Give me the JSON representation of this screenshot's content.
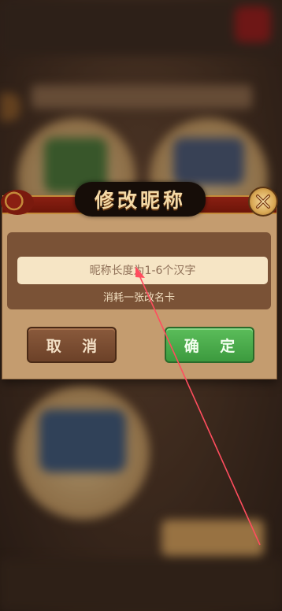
{
  "dialog": {
    "title": "修改昵称",
    "nickname_placeholder": "昵称长度为1-6个汉字",
    "nickname_value": "",
    "cost_note": "消耗一张改名卡",
    "cancel_label": "取 消",
    "confirm_label": "确 定",
    "close_icon": "close-x-icon"
  },
  "colors": {
    "header_red": "#8a1f12",
    "title_gold": "#f4d9a6",
    "confirm_green": "#4aa84a",
    "cancel_brown": "#7a4c30",
    "annotation_red": "#ff4d5e"
  }
}
